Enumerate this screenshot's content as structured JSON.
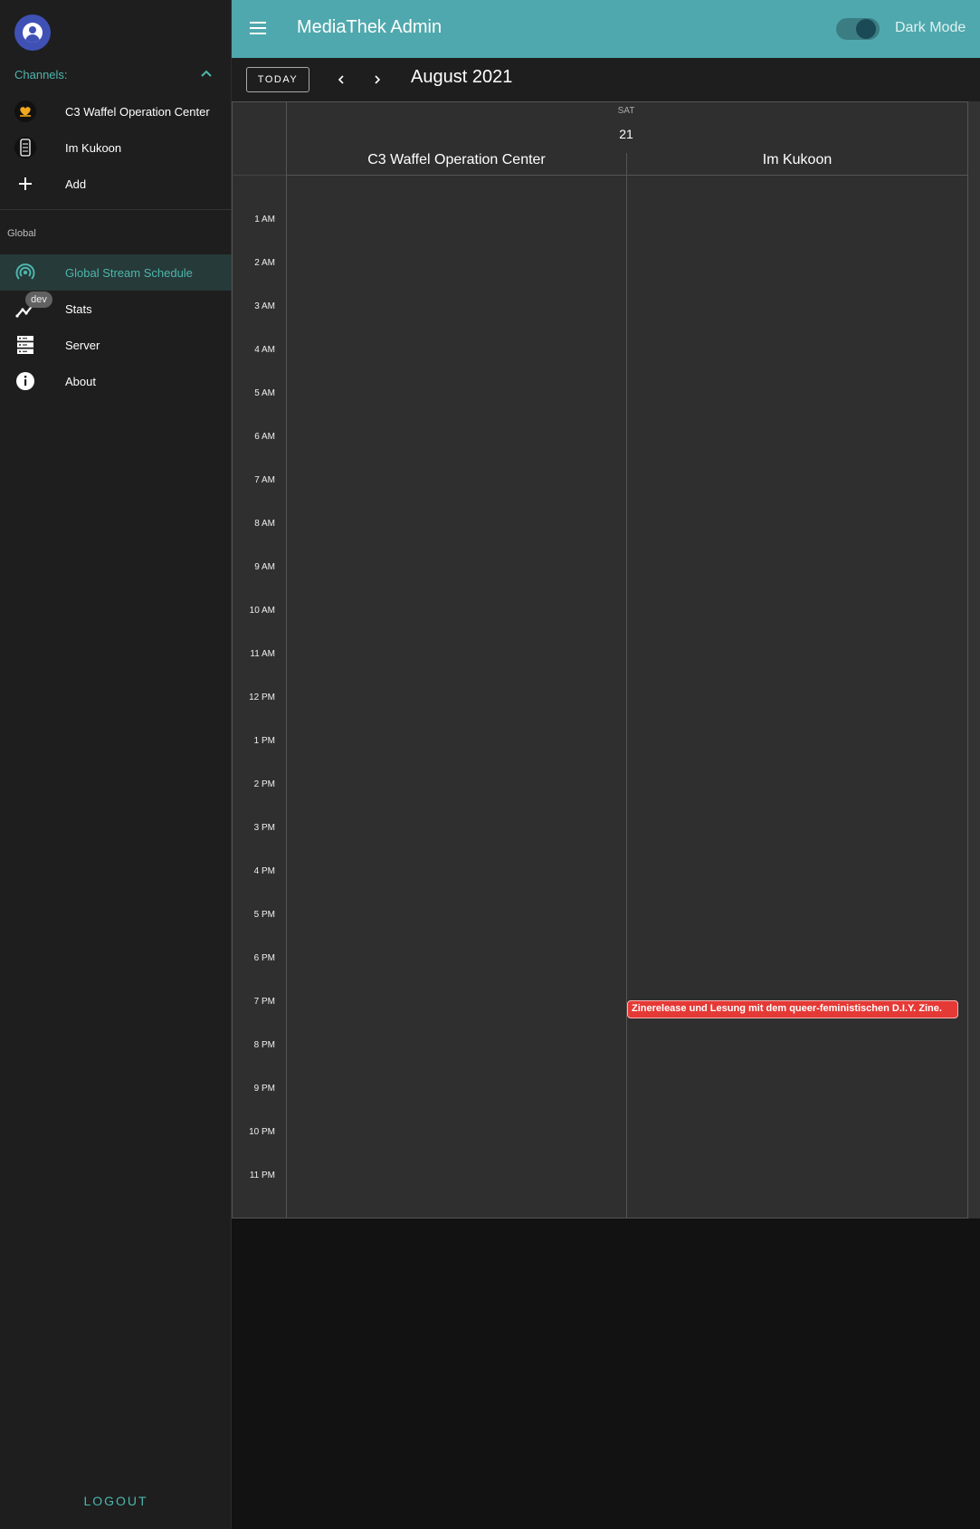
{
  "sidebar": {
    "channels_label": "Channels:",
    "channels": [
      {
        "label": "C3 Waffel Operation Center",
        "icon": "waffle-channel-logo"
      },
      {
        "label": "Im Kukoon",
        "icon": "kukoon-channel-logo"
      },
      {
        "label": "Add",
        "icon": "plus-icon"
      }
    ],
    "global_label": "Global",
    "global_items": [
      {
        "label": "Global Stream Schedule",
        "icon": "broadcast-icon",
        "active": true
      },
      {
        "label": "Stats",
        "icon": "chart-line-icon",
        "badge": "dev"
      },
      {
        "label": "Server",
        "icon": "server-icon"
      },
      {
        "label": "About",
        "icon": "info-icon"
      }
    ],
    "logout_label": "LOGOUT"
  },
  "topbar": {
    "title": "MediaThek Admin",
    "dark_mode_label": "Dark Mode",
    "dark_mode_on": true,
    "accent_color": "#4fa8ad"
  },
  "calendar": {
    "today_label": "TODAY",
    "month_title": "August 2021",
    "day": {
      "dow": "SAT",
      "num": "21"
    },
    "categories": [
      "C3 Waffel Operation Center",
      "Im Kukoon"
    ],
    "hours": [
      "1 AM",
      "2 AM",
      "3 AM",
      "4 AM",
      "5 AM",
      "6 AM",
      "7 AM",
      "8 AM",
      "9 AM",
      "10 AM",
      "11 AM",
      "12 PM",
      "1 PM",
      "2 PM",
      "3 PM",
      "4 PM",
      "5 PM",
      "6 PM",
      "7 PM",
      "8 PM",
      "9 PM",
      "10 PM",
      "11 PM"
    ],
    "events": [
      {
        "title": "Zinerelease und Lesung mit dem queer-feministischen D.I.Y. Zine.",
        "category": "Im Kukoon",
        "color": "#e53935"
      }
    ]
  }
}
